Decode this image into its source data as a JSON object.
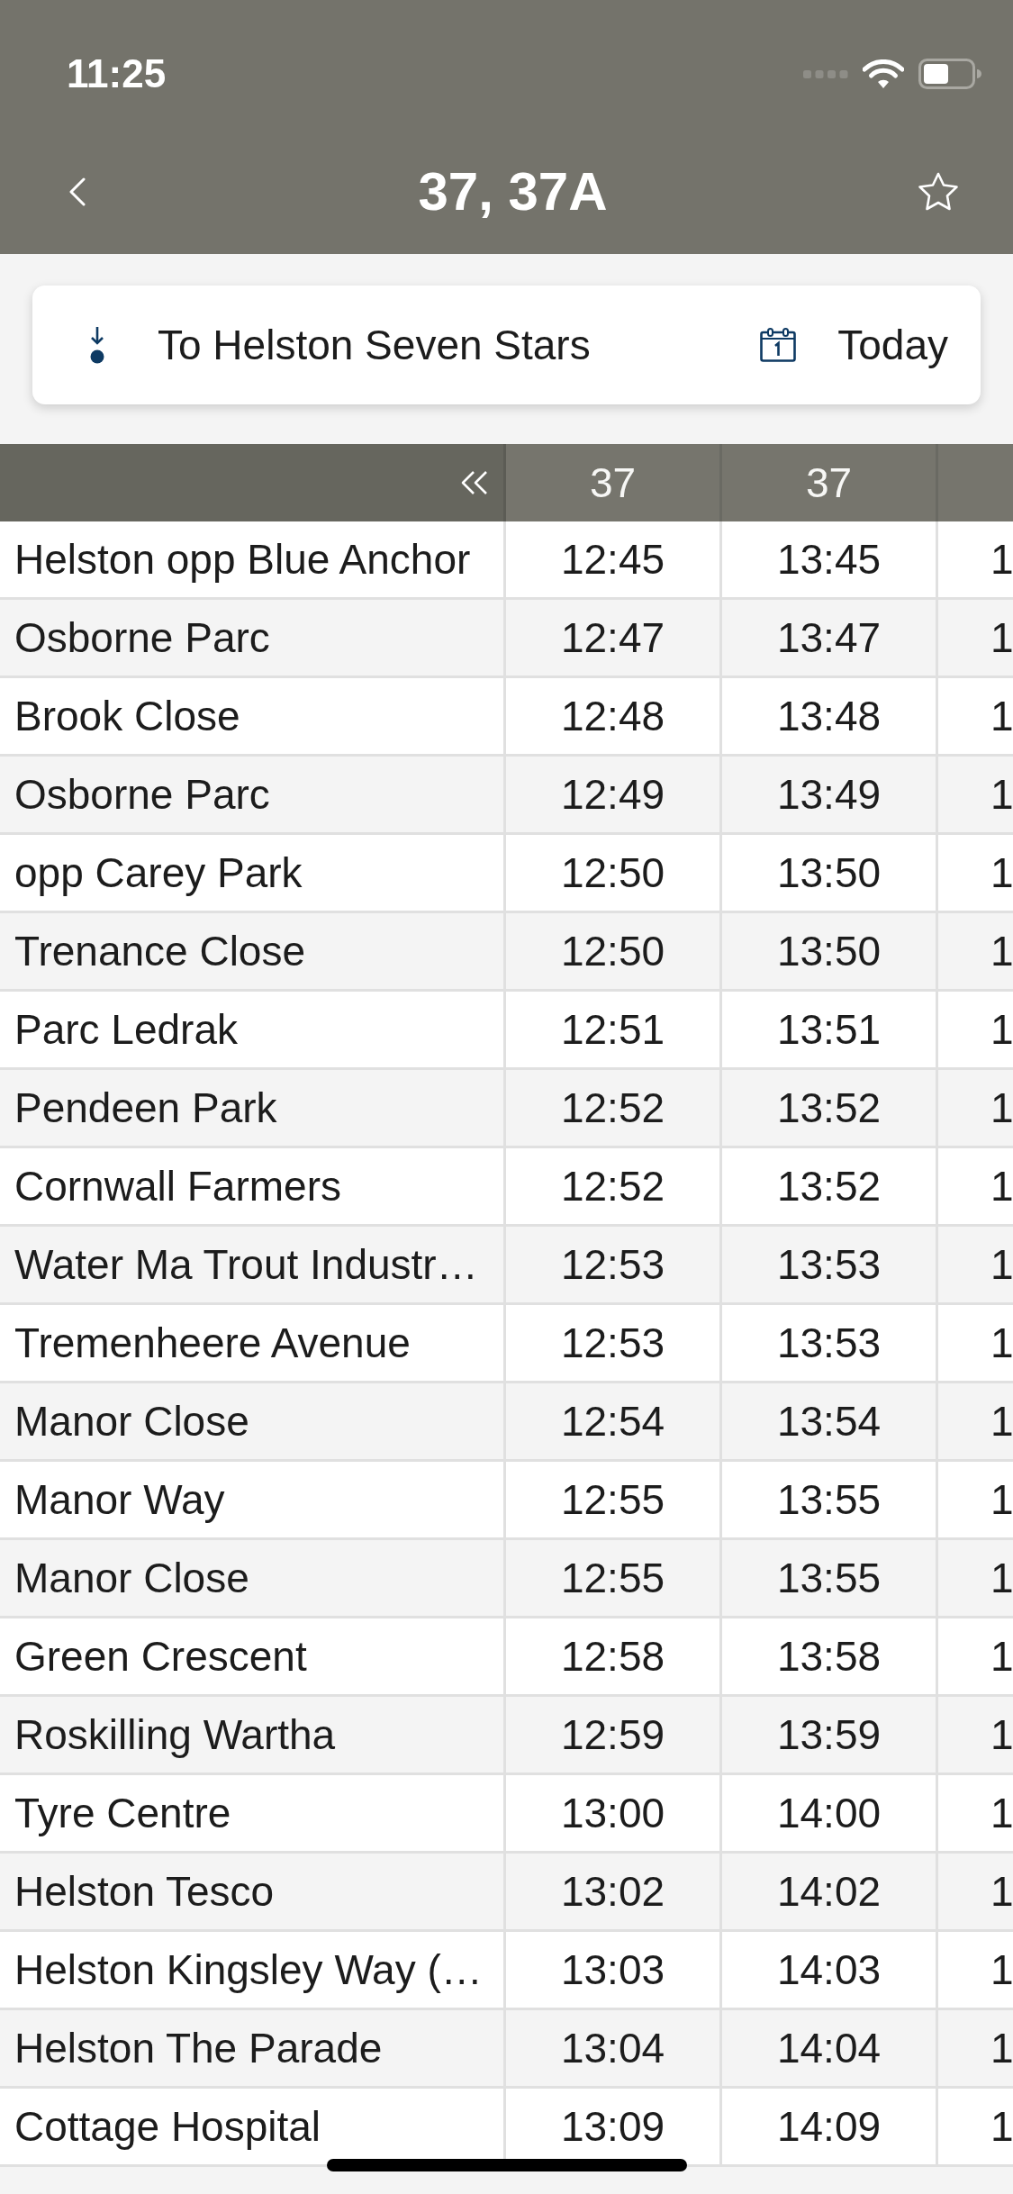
{
  "status_bar": {
    "time": "11:25"
  },
  "nav_bar": {
    "title": "37, 37A",
    "favorite": false
  },
  "filter": {
    "direction": "To Helston Seven Stars",
    "date": "Today"
  },
  "timetable": {
    "columns": [
      "37",
      "37"
    ],
    "rows": [
      {
        "stop": "Helston opp Blue Anchor",
        "times": [
          "12:45",
          "13:45",
          "1"
        ]
      },
      {
        "stop": "Osborne Parc",
        "times": [
          "12:47",
          "13:47",
          "1"
        ]
      },
      {
        "stop": "Brook Close",
        "times": [
          "12:48",
          "13:48",
          "1"
        ]
      },
      {
        "stop": "Osborne Parc",
        "times": [
          "12:49",
          "13:49",
          "1"
        ]
      },
      {
        "stop": "opp Carey Park",
        "times": [
          "12:50",
          "13:50",
          "1"
        ]
      },
      {
        "stop": "Trenance Close",
        "times": [
          "12:50",
          "13:50",
          "1"
        ]
      },
      {
        "stop": "Parc Ledrak",
        "times": [
          "12:51",
          "13:51",
          "1"
        ]
      },
      {
        "stop": "Pendeen Park",
        "times": [
          "12:52",
          "13:52",
          "1"
        ]
      },
      {
        "stop": "Cornwall Farmers",
        "times": [
          "12:52",
          "13:52",
          "1"
        ]
      },
      {
        "stop": "Water Ma Trout Industr…",
        "times": [
          "12:53",
          "13:53",
          "1"
        ]
      },
      {
        "stop": "Tremenheere Avenue",
        "times": [
          "12:53",
          "13:53",
          "1"
        ]
      },
      {
        "stop": "Manor Close",
        "times": [
          "12:54",
          "13:54",
          "1"
        ]
      },
      {
        "stop": "Manor Way",
        "times": [
          "12:55",
          "13:55",
          "1"
        ]
      },
      {
        "stop": "Manor Close",
        "times": [
          "12:55",
          "13:55",
          "1"
        ]
      },
      {
        "stop": "Green Crescent",
        "times": [
          "12:58",
          "13:58",
          "1"
        ]
      },
      {
        "stop": "Roskilling Wartha",
        "times": [
          "12:59",
          "13:59",
          "1"
        ]
      },
      {
        "stop": "Tyre Centre",
        "times": [
          "13:00",
          "14:00",
          "1"
        ]
      },
      {
        "stop": "Helston Tesco",
        "times": [
          "13:02",
          "14:02",
          "1"
        ]
      },
      {
        "stop": "Helston Kingsley Way (…",
        "times": [
          "13:03",
          "14:03",
          "1"
        ]
      },
      {
        "stop": "Helston The Parade",
        "times": [
          "13:04",
          "14:04",
          "1"
        ]
      },
      {
        "stop": "Cottage Hospital",
        "times": [
          "13:09",
          "14:09",
          "1"
        ]
      }
    ]
  }
}
